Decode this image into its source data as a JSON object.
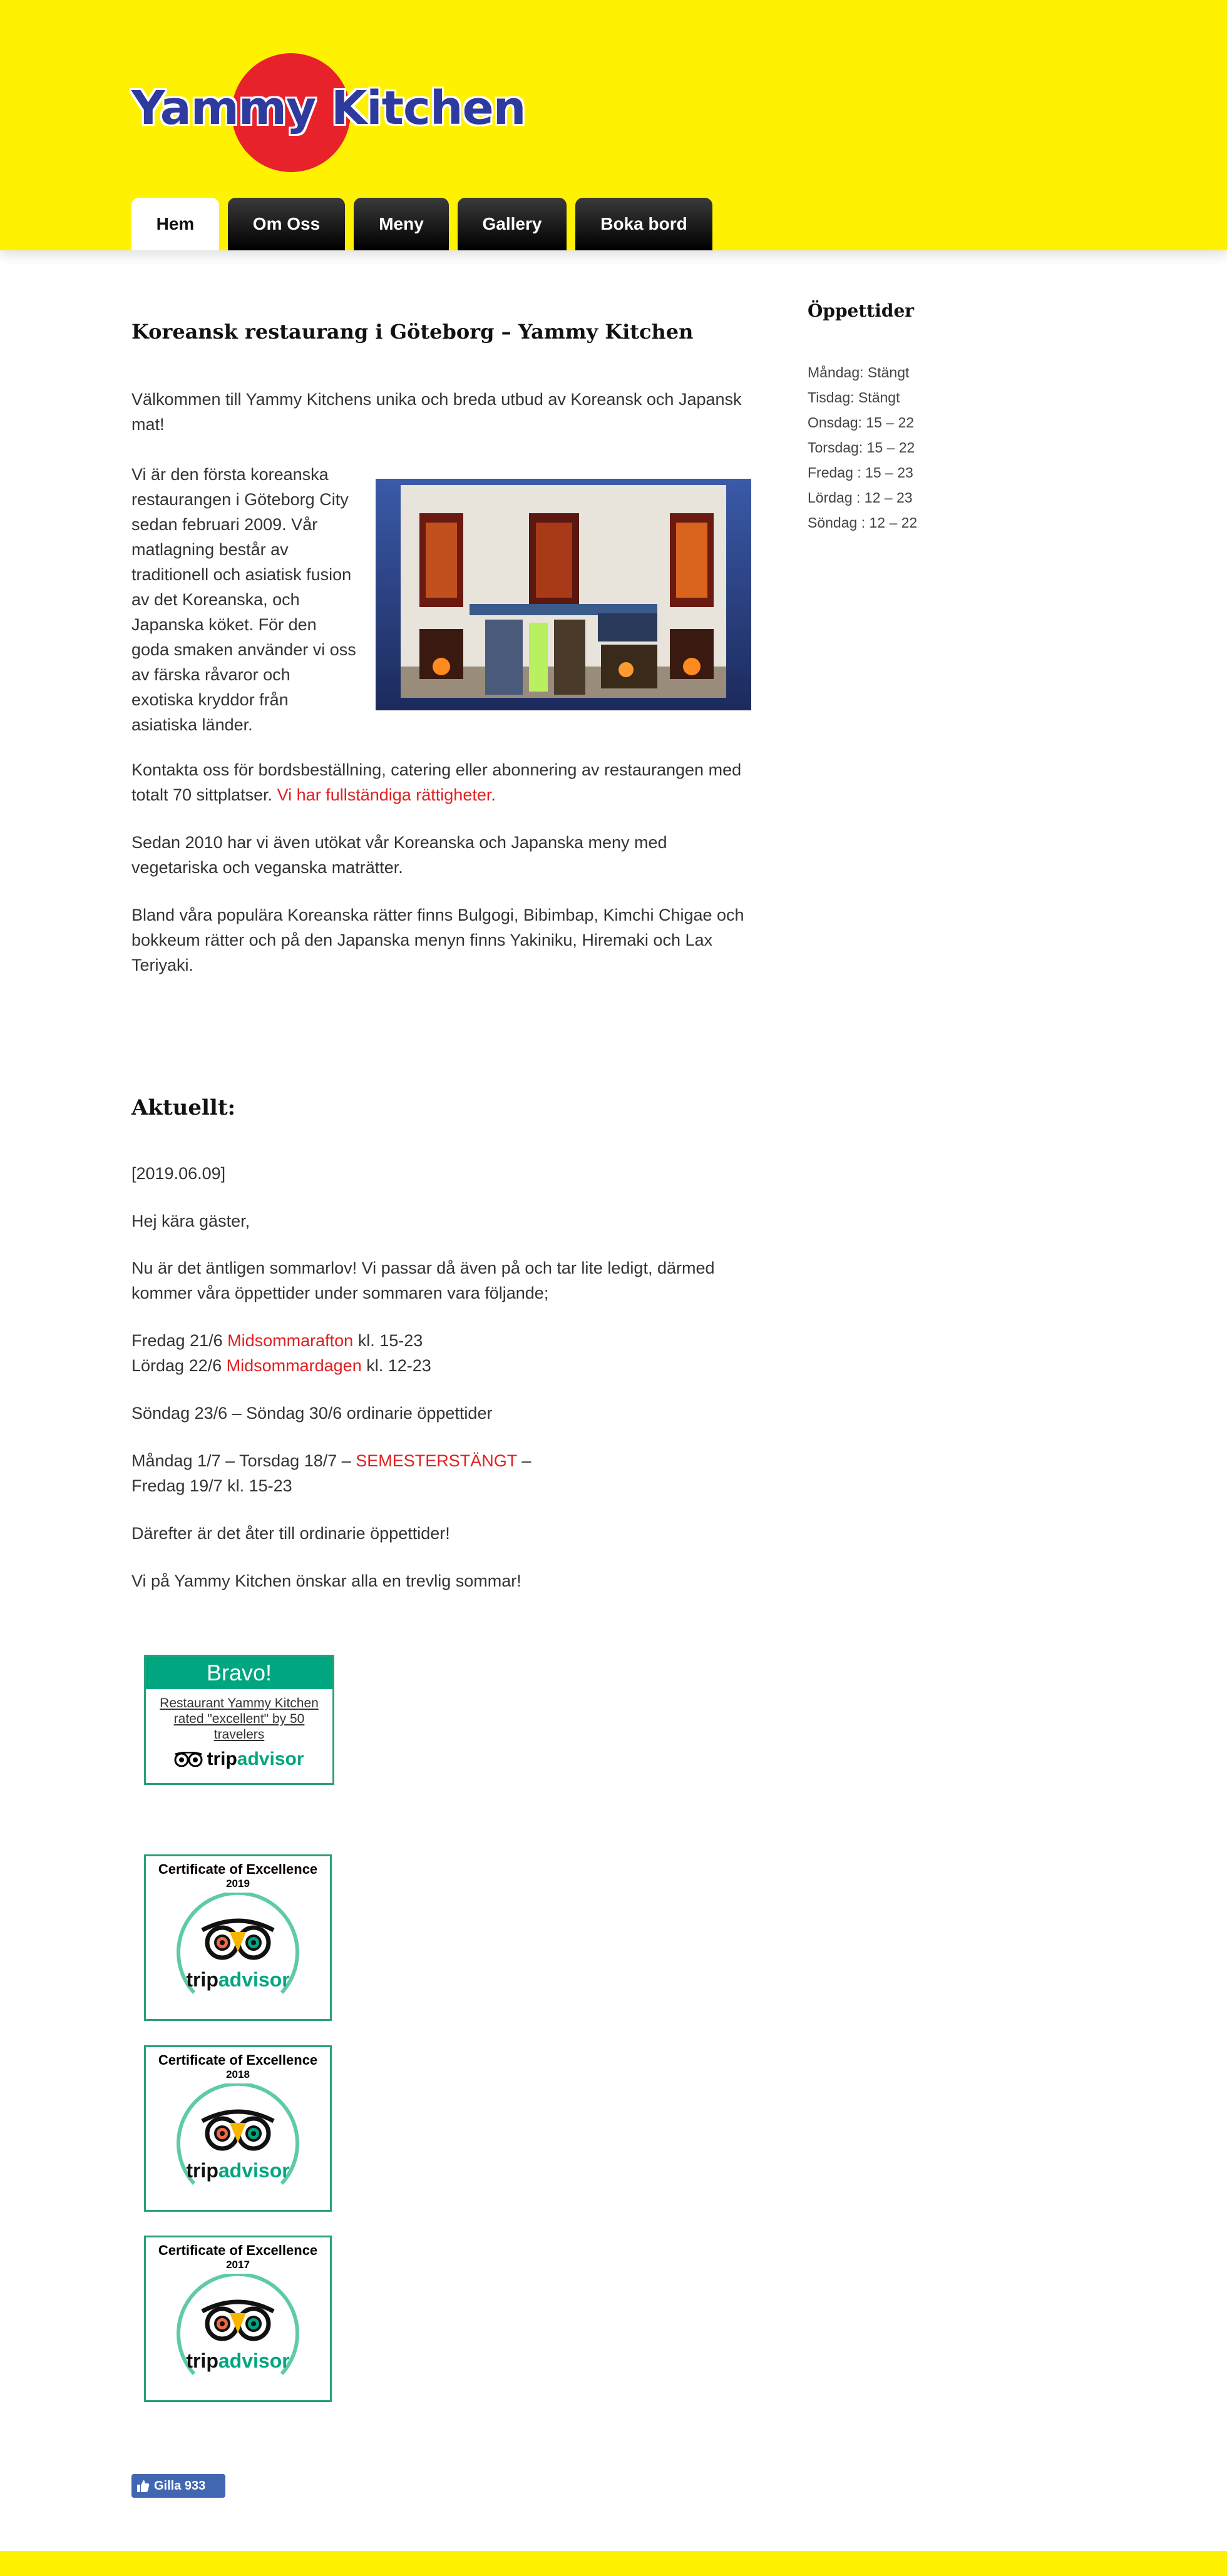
{
  "logo": {
    "text": "Yammy Kitchen"
  },
  "nav": [
    {
      "label": "Hem",
      "active": true
    },
    {
      "label": "Om Oss",
      "active": false
    },
    {
      "label": "Meny",
      "active": false
    },
    {
      "label": "Gallery",
      "active": false
    },
    {
      "label": "Boka bord",
      "active": false
    }
  ],
  "main": {
    "heading": "Koreansk restaurang i Göteborg – Yammy Kitchen",
    "intro": "Välkommen till Yammy Kitchens unika och breda utbud av Koreansk och Japansk mat!",
    "about": "Vi är den första koreanska restaurangen i Göteborg City sedan februari 2009. Vår matlagning består av traditionell och asiatisk fusion av det Koreanska, och Japanska köket. För den goda smaken använder vi oss av färska råvaror och exotiska kryddor från asiatiska länder.",
    "contact": "Kontakta oss för bordsbeställning, catering eller abonnering av restaurangen med totalt 70 sittplatser.",
    "rights_link": "Vi har fullständiga rättigheter",
    "since2010": "Sedan 2010 har vi även utökat vår Koreanska och Japanska meny med vegetariska och veganska maträtter.",
    "popular": "Bland våra populära Koreanska rätter finns Bulgogi, Bibimbap, Kimchi Chigae och bokkeum rätter och på den Japanska menyn finns Yakiniku, Hiremaki och Lax Teriyaki."
  },
  "news": {
    "heading": "Aktuellt:",
    "date": "[2019.06.09]",
    "greeting": "Hej kära gäster,",
    "summer": "Nu är det äntligen sommarlov! Vi passar då även på och tar lite ledigt, därmed kommer våra öppettider under sommaren vara följande;",
    "fri_prefix": "Fredag 21/6 ",
    "fri_red": "Midsommarafton",
    "fri_suffix": " kl. 15-23",
    "sat_prefix": "Lördag 22/6 ",
    "sat_red": "Midsommardagen",
    "sat_suffix": " kl. 12-23",
    "ordinary": "Söndag 23/6 – Söndag 30/6 ordinarie öppettider",
    "closed_prefix": "Måndag 1/7 – Torsdag 18/7 – ",
    "closed_red": "SEMESTERSTÄNGT",
    "closed_suffix": " –",
    "reopen": "Fredag 19/7 kl. 15-23",
    "after": "Därefter är det åter till ordinarie öppettider!",
    "wish": "Vi på Yammy Kitchen önskar alla en trevlig sommar!"
  },
  "sidebar": {
    "title": "Öppettider",
    "hours": [
      "Måndag: Stängt",
      "Tisdag: Stängt",
      "Onsdag: 15 – 22",
      "Torsdag: 15 – 22",
      "Fredag : 15 – 23",
      "Lördag : 12 – 23",
      "Söndag : 12 – 22"
    ]
  },
  "badges": {
    "bravo_title": "Bravo!",
    "bravo_text": "Restaurant Yammy Kitchen rated \"excellent\" by 50 travelers",
    "ta_trip": "trip",
    "ta_advisor": "advisor",
    "cert_title": "Certificate of Excellence",
    "certs": [
      {
        "year": "2019"
      },
      {
        "year": "2018"
      },
      {
        "year": "2017"
      }
    ]
  },
  "facebook": {
    "label": "Gilla 933"
  },
  "colors": {
    "header_bg": "#fff200",
    "link_red": "#e02020",
    "ta_green": "#00a680"
  }
}
